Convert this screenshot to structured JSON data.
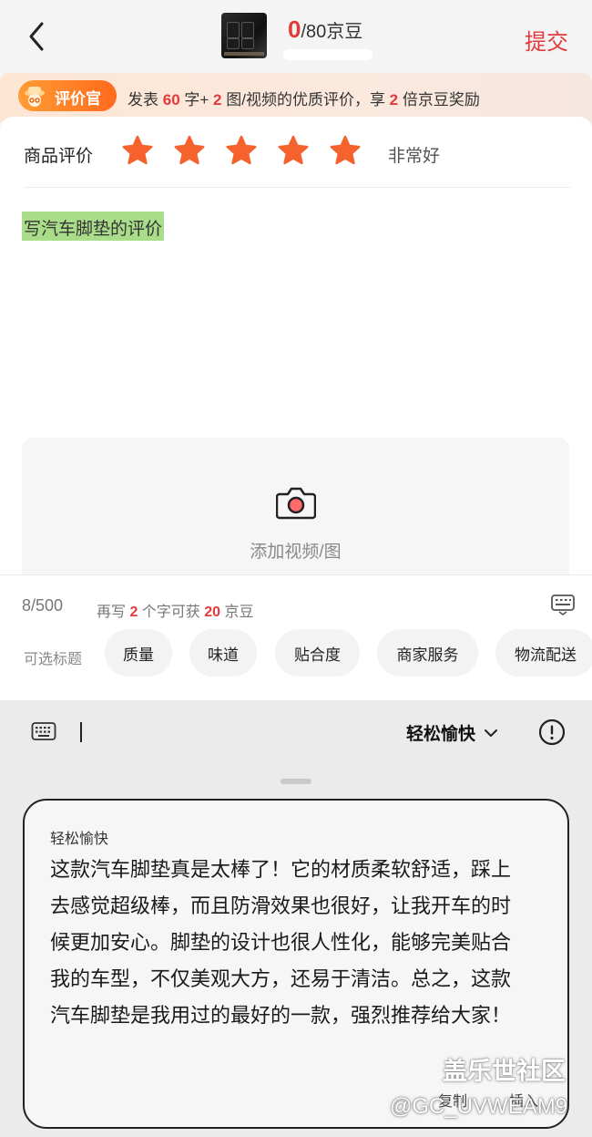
{
  "header": {
    "count_current": "0",
    "count_total": "/80京豆",
    "submit_label": "提交"
  },
  "banner": {
    "badge_label": "评价官",
    "text_parts": [
      "发表 ",
      "60",
      " 字+ ",
      "2",
      " 图/视频的优质评价，享 ",
      "2",
      " 倍京豆奖励"
    ]
  },
  "review": {
    "rating_label": "商品评价",
    "stars": 5,
    "star_color": "#f5622d",
    "rating_text": "非常好",
    "placeholder_hint": "写汽车脚垫的评价",
    "upload_label": "添加视频/图"
  },
  "info_bar": {
    "char_count": "8/500",
    "reward_parts": [
      "再写 ",
      "2",
      " 个字可获 ",
      "20",
      " 京豆"
    ],
    "tags_label": "可选标题",
    "tags": [
      "质量",
      "味道",
      "贴合度",
      "商家服务",
      "物流配送"
    ]
  },
  "assistant": {
    "style_label": "轻松愉快",
    "suggestion_title": "轻松愉快",
    "suggestion_text": "这款汽车脚垫真是太棒了！它的材质柔软舒适，踩上去感觉超级棒，而且防滑效果也很好，让我开车的时候更加安心。脚垫的设计也很人性化，能够完美贴合我的车型，不仅美观大方，还易于清洁。总之，这款汽车脚垫是我用过的最好的一款，强烈推荐给大家！",
    "copy_label": "复制",
    "insert_label": "插入"
  },
  "watermark": {
    "line1": "盖乐世社区",
    "line2": "@GC_UVWEAM9"
  },
  "colors": {
    "accent": "#e4393c",
    "highlight": "#a9dd8a"
  }
}
